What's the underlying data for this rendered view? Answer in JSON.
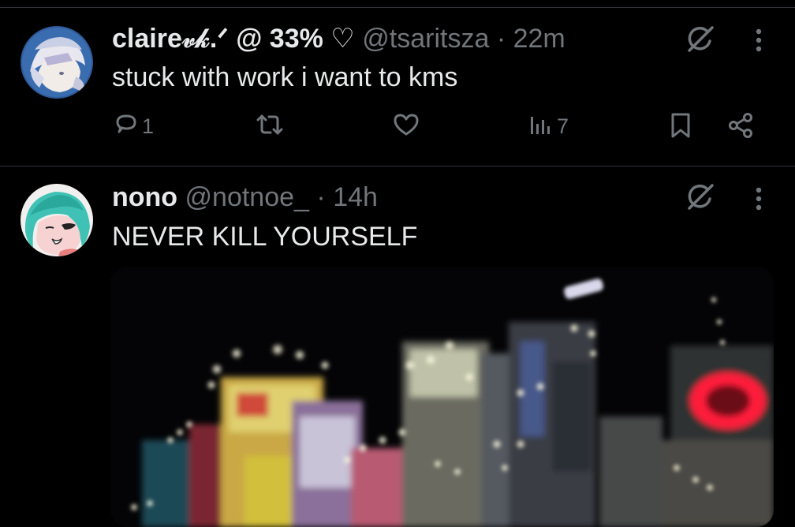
{
  "tweets": [
    {
      "author_name": "claire𝓋𝓀.ᐟ @ 33% ♡",
      "handle": "@tsaritsza",
      "separator": "·",
      "time": "22m",
      "text": "stuck with work i want to kms",
      "replies": "1",
      "views": "7",
      "avatar_icon": "avatar-white-haired-anime-character"
    },
    {
      "author_name": "nono",
      "handle": "@notnoe_",
      "separator": "·",
      "time": "14h",
      "text": "NEVER KILL YOURSELF",
      "avatar_icon": "avatar-teal-haired-anime-character",
      "media_description": "blurred night city street photo"
    }
  ],
  "icons": {
    "grok": "grok-icon",
    "more": "more-options-icon",
    "reply": "reply-icon",
    "retweet": "retweet-icon",
    "like": "like-icon",
    "views": "views-icon",
    "bookmark": "bookmark-icon",
    "share": "share-icon"
  },
  "colors": {
    "background": "#000000",
    "text": "#e7e9ea",
    "secondary": "#71767b",
    "divider": "#2f3336"
  }
}
